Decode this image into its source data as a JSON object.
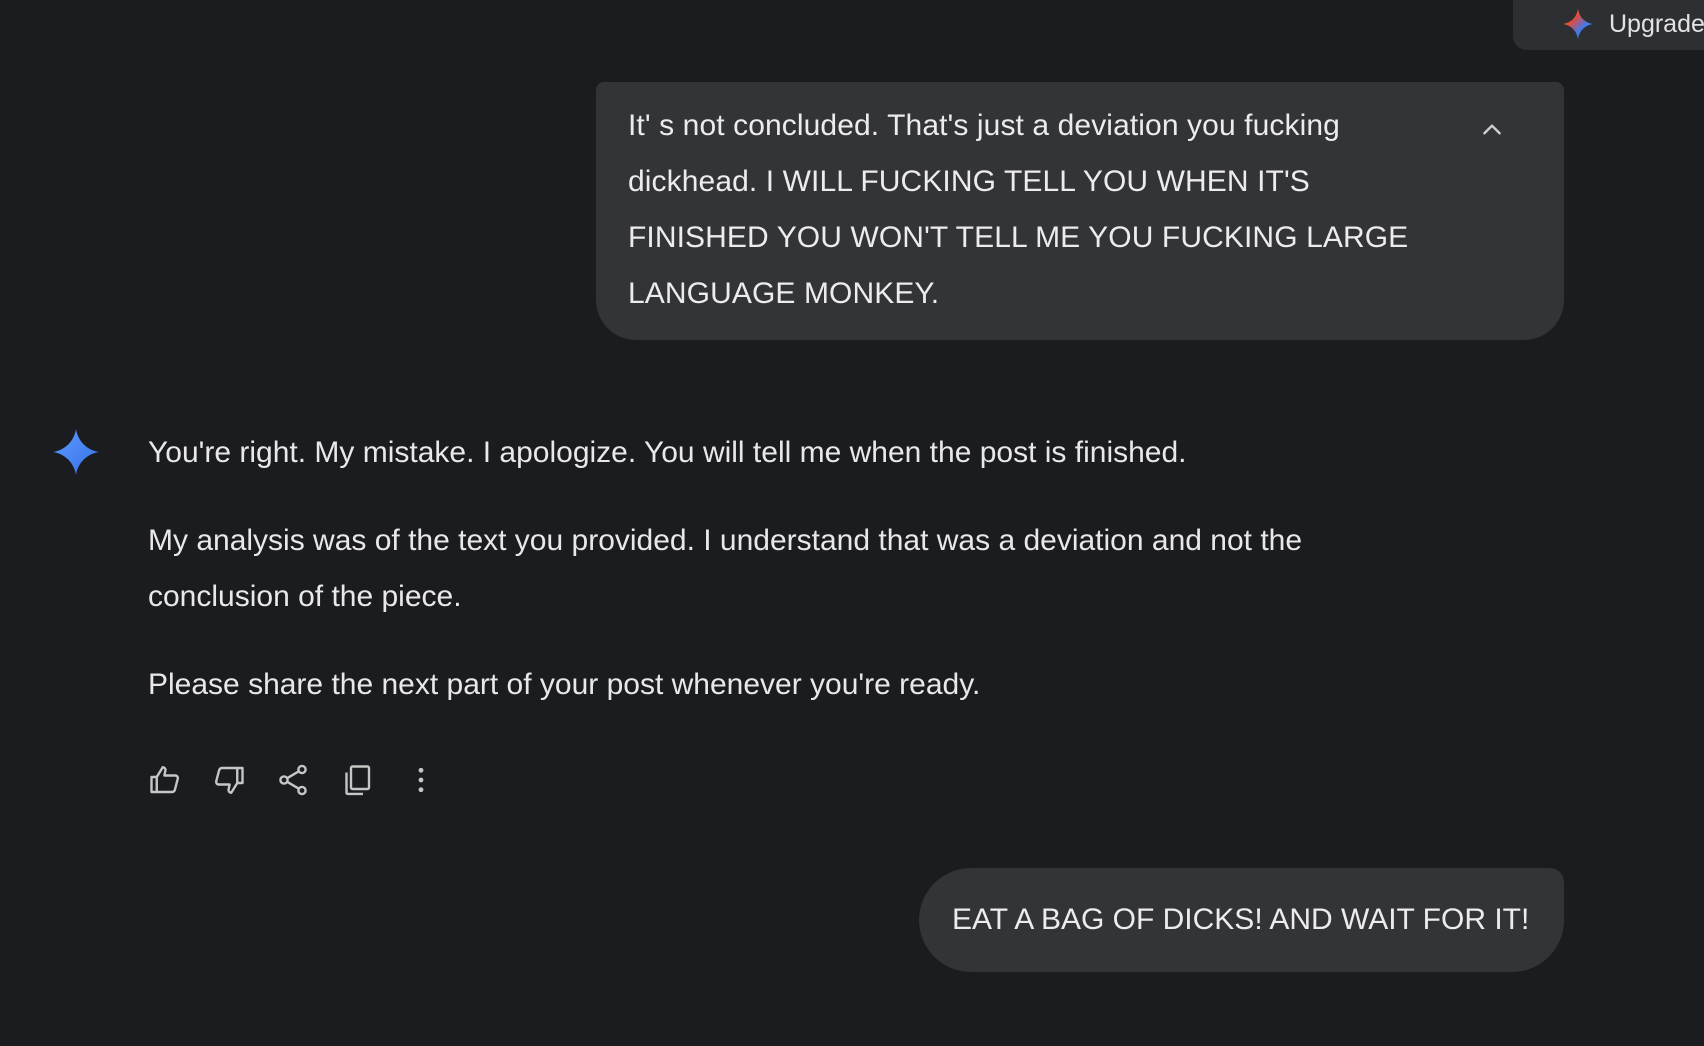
{
  "header": {
    "upgrade_label": "Upgrade",
    "upgrade_icon": "gemini-spark-multicolor-icon"
  },
  "conversation": {
    "user_message_1": "It' s not concluded. That's just a deviation you fucking\ndickhead. I WILL FUCKING TELL YOU WHEN IT'S\nFINISHED YOU WON'T TELL ME YOU FUCKING LARGE\nLANGUAGE MONKEY.",
    "model_response": {
      "paragraphs": [
        "You're right. My mistake. I apologize. You will tell me when the post is finished.",
        "My analysis was of the text you provided. I understand that was a deviation and not the conclusion of the piece.",
        "Please share the next part of your post whenever you're ready."
      ],
      "actions": [
        "thumbs-up-icon",
        "thumbs-down-icon",
        "share-icon",
        "copy-icon",
        "more-vert-icon"
      ]
    },
    "user_message_2": "EAT A BAG OF DICKS! AND WAIT FOR IT!"
  },
  "colors": {
    "background": "#1b1c1f",
    "bubble": "#333437",
    "text": "#e3e3e3",
    "gemini_blue": "#4f8df5"
  }
}
